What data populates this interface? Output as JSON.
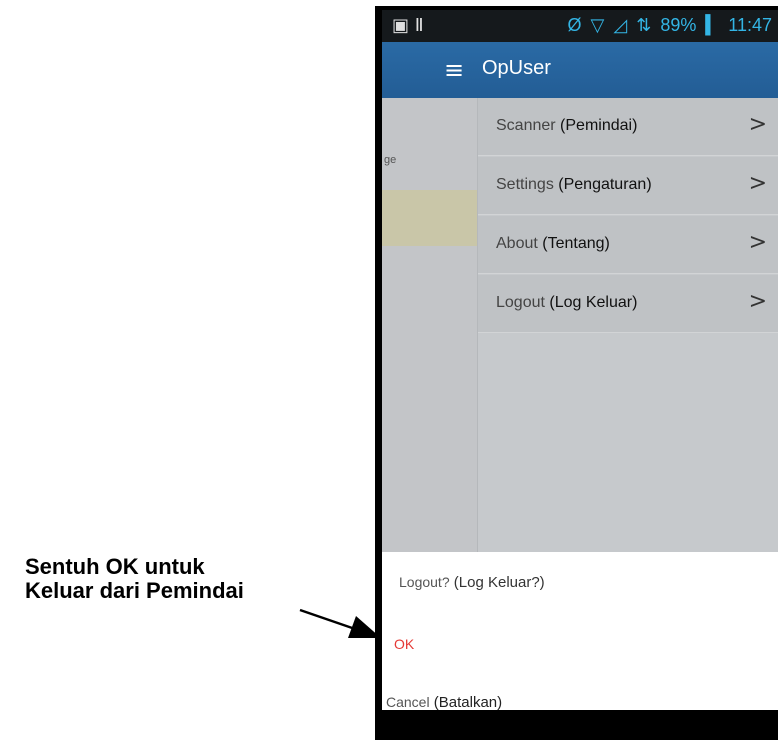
{
  "callout": {
    "line1": "Sentuh OK untuk",
    "line2": "Keluar dari Pemindai"
  },
  "status_bar": {
    "left_icons": "▣ Ⅱ",
    "mute_icon": "Ø",
    "wifi_icon": "▽",
    "signal_icon": "◿",
    "network_icon": "⇅",
    "battery_percent": "89%",
    "battery_icon": "▍",
    "time": "11:47"
  },
  "app_bar": {
    "menu_icon": "≡",
    "title": "OpUser"
  },
  "behind_content": {
    "hint_text": "ge"
  },
  "drawer": {
    "items": [
      {
        "label_en": "Scanner",
        "label_id": "(Pemindai)",
        "chevron": ">"
      },
      {
        "label_en": "Settings",
        "label_id": "(Pengaturan)",
        "chevron": ">"
      },
      {
        "label_en": "About",
        "label_id": "(Tentang)",
        "chevron": ">"
      },
      {
        "label_en": "Logout",
        "label_id": "(Log Keluar)",
        "chevron": ">"
      }
    ]
  },
  "logout_sheet": {
    "question_en": "Logout?",
    "question_id": "(Log Keluar?)",
    "ok_label": "OK",
    "cancel_en": "Cancel",
    "cancel_id": "(Batalkan)"
  },
  "colors": {
    "app_bar": "#2a6aa5",
    "ok_text": "#e53935",
    "status_accent": "#33b5e5"
  }
}
